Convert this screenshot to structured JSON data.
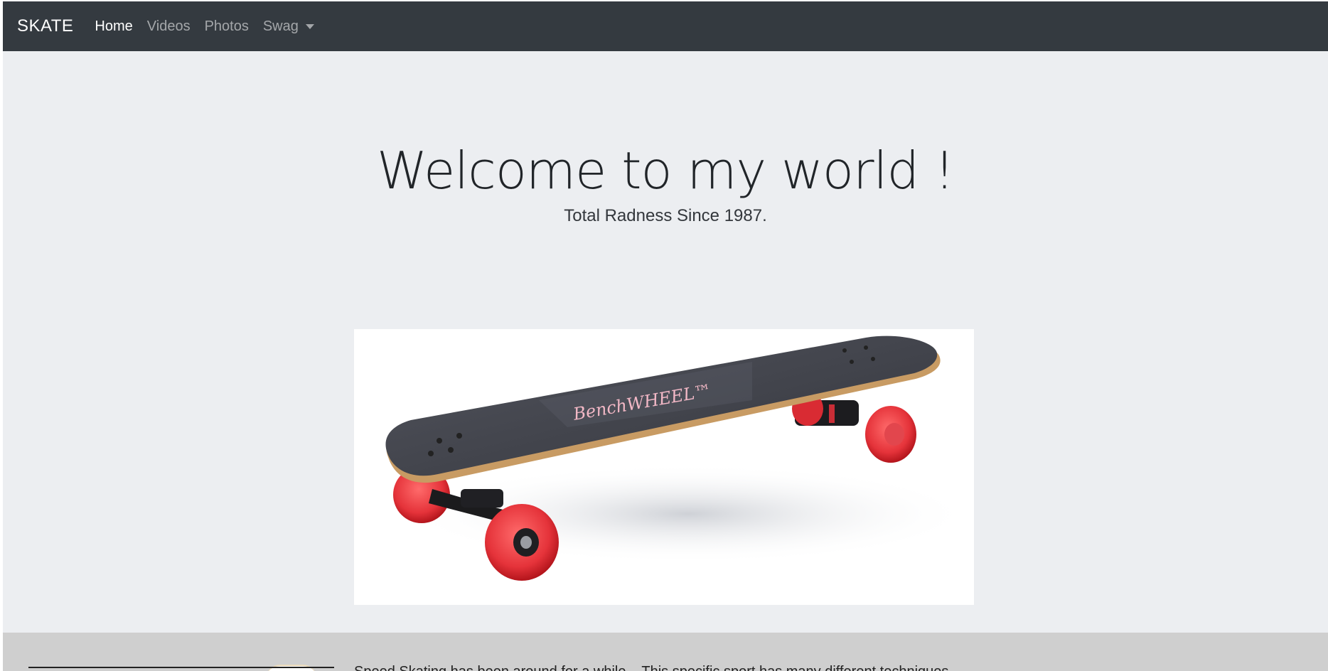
{
  "navbar": {
    "brand": "SKATE",
    "items": [
      {
        "label": "Home",
        "active": true
      },
      {
        "label": "Videos",
        "active": false
      },
      {
        "label": "Photos",
        "active": false
      },
      {
        "label": "Swag",
        "active": false,
        "dropdown": true
      }
    ]
  },
  "hero": {
    "title": "Welcome to my world !",
    "subtitle": "Total Radness Since 1987.",
    "image": {
      "board_text": "BenchWHEEL™",
      "deck_color": "#3f4149",
      "wheel_color": "#e5333a"
    }
  },
  "footer": {
    "text": "Speed Skating has been around for a while... This specific sport has many different techniques"
  },
  "colors": {
    "navbar_bg": "#343a40",
    "hero_bg": "#eceef1",
    "footer_bg": "#cfcfcf"
  }
}
